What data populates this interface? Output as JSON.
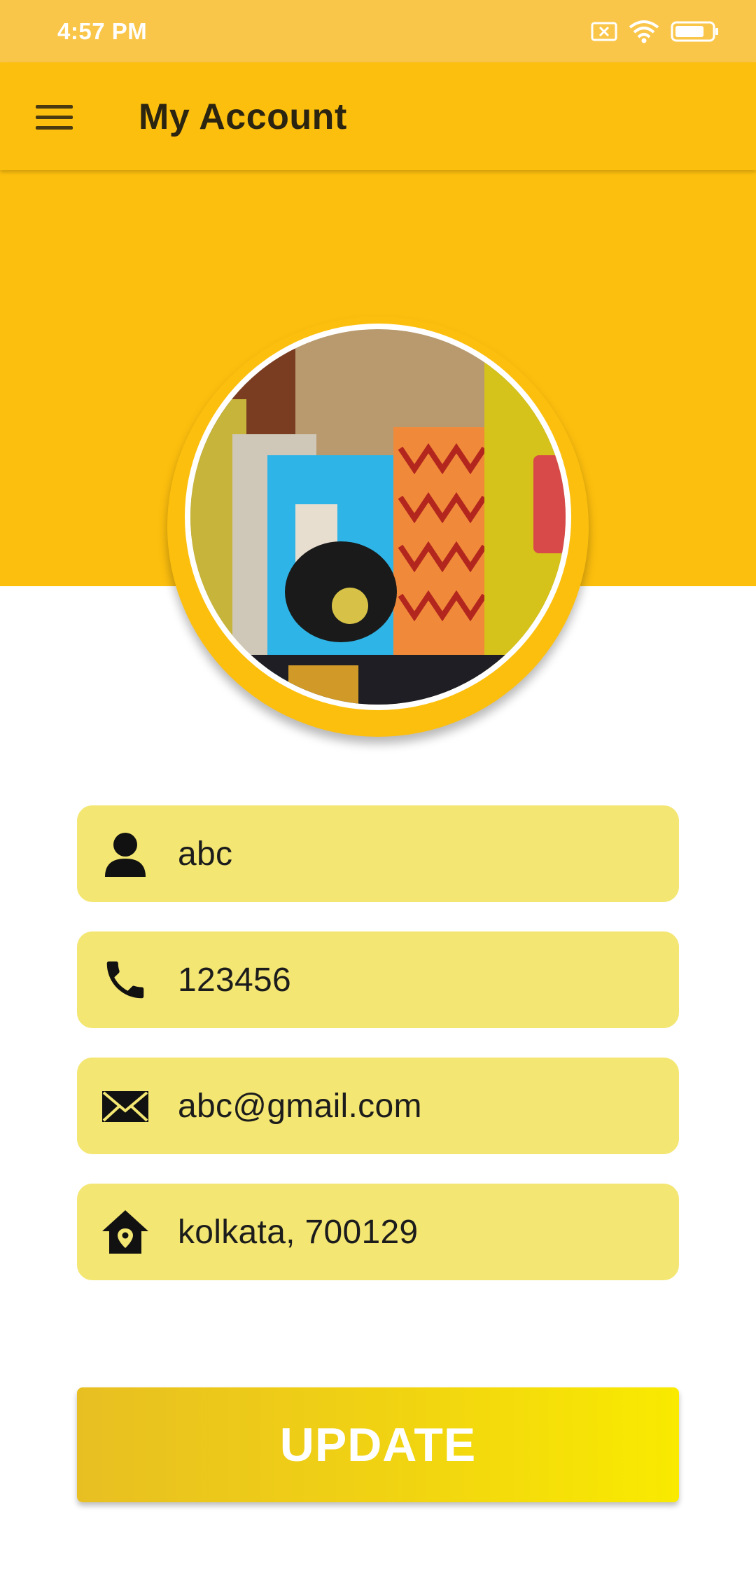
{
  "status_bar": {
    "time": "4:57 PM",
    "icons": [
      "sim-error-icon",
      "wifi-icon",
      "battery-icon"
    ]
  },
  "app_bar": {
    "title": "My Account",
    "menu_icon": "hamburger-menu-icon"
  },
  "profile": {
    "fields": [
      {
        "icon": "person-icon",
        "value": "abc"
      },
      {
        "icon": "phone-icon",
        "value": "123456"
      },
      {
        "icon": "mail-icon",
        "value": "abc@gmail.com"
      },
      {
        "icon": "home-location-icon",
        "value": "kolkata, 700129"
      }
    ],
    "update_label": "UPDATE"
  },
  "colors": {
    "status_bar": "#FAC64A",
    "accent": "#FDBF0E",
    "field_bg": "#F3E672",
    "button_gradient_start": "#E8BF22",
    "button_gradient_end": "#F9EA00"
  }
}
